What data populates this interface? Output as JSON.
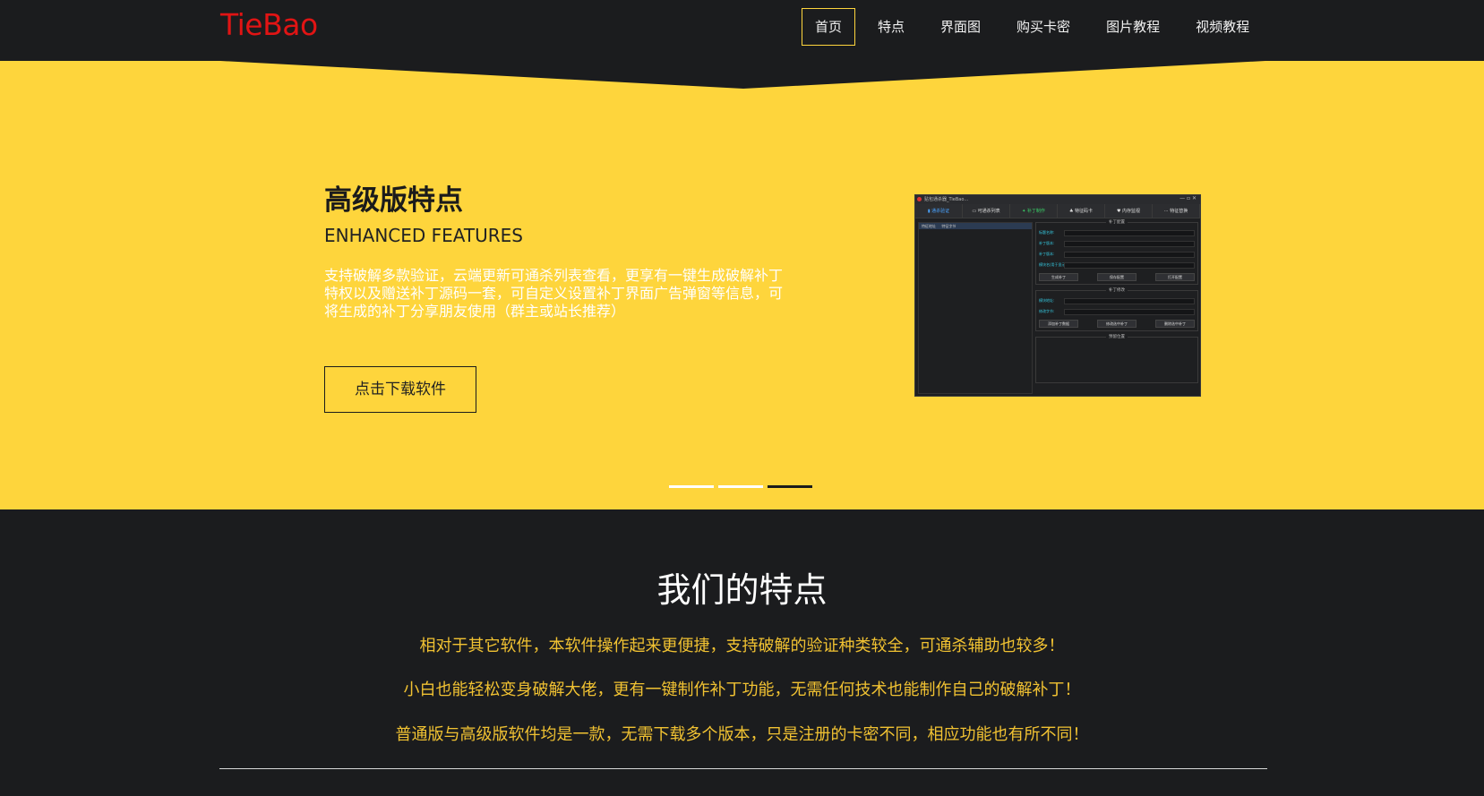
{
  "header": {
    "logo": "TieBao",
    "nav": [
      {
        "label": "首页",
        "active": true
      },
      {
        "label": "特点",
        "active": false
      },
      {
        "label": "界面图",
        "active": false
      },
      {
        "label": "购买卡密",
        "active": false
      },
      {
        "label": "图片教程",
        "active": false
      },
      {
        "label": "视频教程",
        "active": false
      }
    ]
  },
  "hero": {
    "title": "高级版特点",
    "subtitle": "ENHANCED FEATURES",
    "description": "支持破解多款验证，云端更新可通杀列表查看，更享有一键生成破解补丁特权以及赠送补丁源码一套，可自定义设置补丁界面广告弹窗等信息，可将生成的补丁分享朋友使用（群主或站长推荐）",
    "button_label": "点击下载软件",
    "carousel": {
      "slides": 3,
      "active_index": 2
    },
    "app_screenshot": {
      "titlebar": "贴包通杀器_TieBao…",
      "tabs": [
        "▮ 通杀验证",
        "▭ 可通杀列表",
        "✦ 补丁制作",
        "♣ 特征码卡",
        "♥ 内存监视",
        "⋯ 特征替换"
      ],
      "left_headers": [
        "特征地址",
        "特征字节"
      ],
      "groups": [
        {
          "title": "补丁配置",
          "rows": [
            "标题名称:",
            "补丁版本:",
            "补丁版本:",
            "模块名(用于显示):"
          ],
          "buttons": [
            "生成补丁",
            "保存配置",
            "打开配置"
          ]
        },
        {
          "title": "补丁修改",
          "rows": [
            "模块地址:",
            "修改字节:"
          ],
          "buttons": [
            "添加补丁数据",
            "修改选中补丁",
            "删除选中补丁"
          ]
        },
        {
          "title": "预留位置",
          "rows": [],
          "buttons": []
        }
      ]
    }
  },
  "features": {
    "title": "我们的特点",
    "lines": [
      "相对于其它软件，本软件操作起来更便捷，支持破解的验证种类较全，可通杀辅助也较多！",
      "小白也能轻松变身破解大佬，更有一键制作补丁功能，无需任何技术也能制作自己的破解补丁！",
      "普通版与高级版软件均是一款，无需下载多个版本，只是注册的卡密不同，相应功能也有所不同！"
    ]
  },
  "colors": {
    "accent_yellow": "#fed53c",
    "dark_bg": "#1b1c1e",
    "logo_red": "#e11414",
    "feature_text": "#f1c232"
  }
}
